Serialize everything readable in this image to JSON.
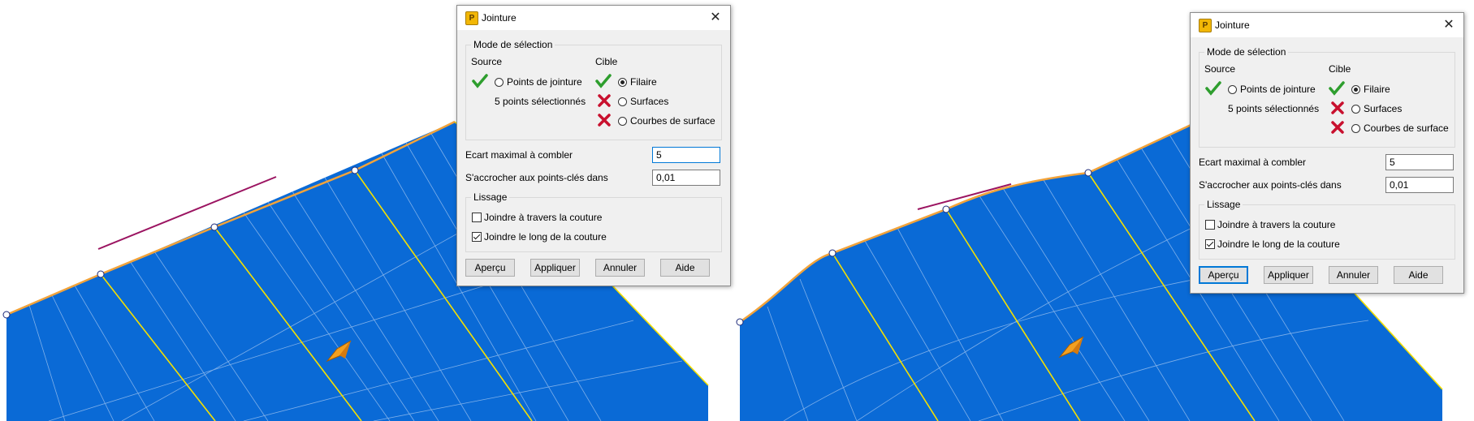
{
  "dialogs": [
    {
      "title": "Jointure",
      "app_icon": "app-logo-icon",
      "close_glyph": "✕",
      "selection_mode": {
        "legend": "Mode de sélection",
        "source_label": "Source",
        "target_label": "Cible",
        "source_option": "Points de jointure",
        "source_status": "5 points sélectionnés",
        "target_options": [
          "Filaire",
          "Surfaces",
          "Courbes de surface"
        ],
        "target_selected": "Filaire"
      },
      "max_gap_label": "Ecart maximal à combler",
      "max_gap_value": "5",
      "snap_label": "S'accrocher aux points-clés dans",
      "snap_value": "0,01",
      "smoothing": {
        "legend": "Lissage",
        "across_seam": "Joindre à travers la couture",
        "across_checked": false,
        "along_seam": "Joindre le long de la couture",
        "along_checked": true
      },
      "buttons": [
        "Aperçu",
        "Appliquer",
        "Annuler",
        "Aide"
      ]
    },
    {
      "title": "Jointure",
      "app_icon": "app-logo-icon",
      "close_glyph": "✕",
      "selection_mode": {
        "legend": "Mode de sélection",
        "source_label": "Source",
        "target_label": "Cible",
        "source_option": "Points de jointure",
        "source_status": "5 points sélectionnés",
        "target_options": [
          "Filaire",
          "Surfaces",
          "Courbes de surface"
        ],
        "target_selected": "Filaire"
      },
      "max_gap_label": "Ecart maximal à combler",
      "max_gap_value": "5",
      "snap_label": "S'accrocher aux points-clés dans",
      "snap_value": "0,01",
      "smoothing": {
        "legend": "Lissage",
        "across_seam": "Joindre à travers la couture",
        "across_checked": false,
        "along_seam": "Joindre le long de la couture",
        "along_checked": true
      },
      "buttons": [
        "Aperçu",
        "Appliquer",
        "Annuler",
        "Aide"
      ]
    }
  ],
  "colors": {
    "surface": "#0a6ad6",
    "surface_border": "#f0d000",
    "edge": "#f2a33a",
    "seam": "#f4e000",
    "isoparm": "#7fb0ea",
    "gap_curve": "#9b1461",
    "success": "#2e9e2e",
    "error": "#c8102e"
  }
}
